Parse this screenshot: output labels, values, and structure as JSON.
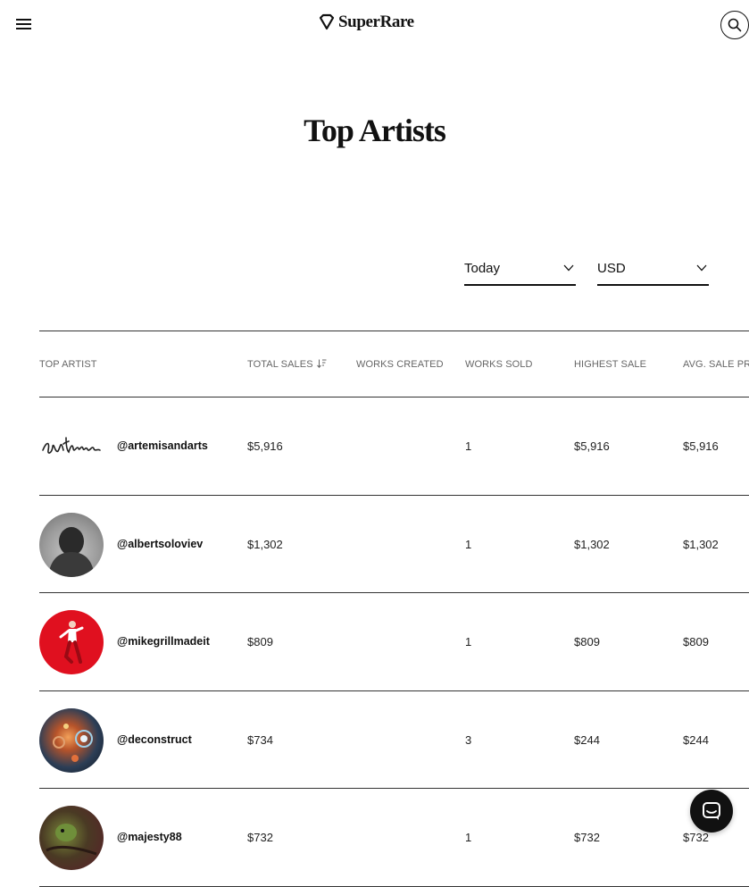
{
  "header": {
    "logo_text": "SuperRare",
    "menu_icon": "hamburger-menu-icon",
    "search_icon": "search-icon"
  },
  "page": {
    "title": "Top Artists"
  },
  "filters": {
    "period": {
      "selected": "Today"
    },
    "currency": {
      "selected": "USD"
    }
  },
  "table": {
    "columns": {
      "artist": "TOP ARTIST",
      "total": "TOTAL SALES",
      "created": "WORKS CREATED",
      "sold": "WORKS SOLD",
      "high": "HIGHEST SALE",
      "avg": "AVG. SALE PRICE"
    },
    "rows": [
      {
        "handle": "@artemisandarts",
        "total": "$5,916",
        "created": "",
        "sold": "1",
        "high": "$5,916",
        "avg": "$5,916"
      },
      {
        "handle": "@albertsoloviev",
        "total": "$1,302",
        "created": "",
        "sold": "1",
        "high": "$1,302",
        "avg": "$1,302"
      },
      {
        "handle": "@mikegrillmadeit",
        "total": "$809",
        "created": "",
        "sold": "1",
        "high": "$809",
        "avg": "$809"
      },
      {
        "handle": "@deconstruct",
        "total": "$734",
        "created": "",
        "sold": "3",
        "high": "$244",
        "avg": "$244"
      },
      {
        "handle": "@majesty88",
        "total": "$732",
        "created": "",
        "sold": "1",
        "high": "$732",
        "avg": "$732"
      }
    ]
  },
  "colors": {
    "text": "#111111",
    "muted": "#666666",
    "avatar_red": "#e0101f"
  }
}
